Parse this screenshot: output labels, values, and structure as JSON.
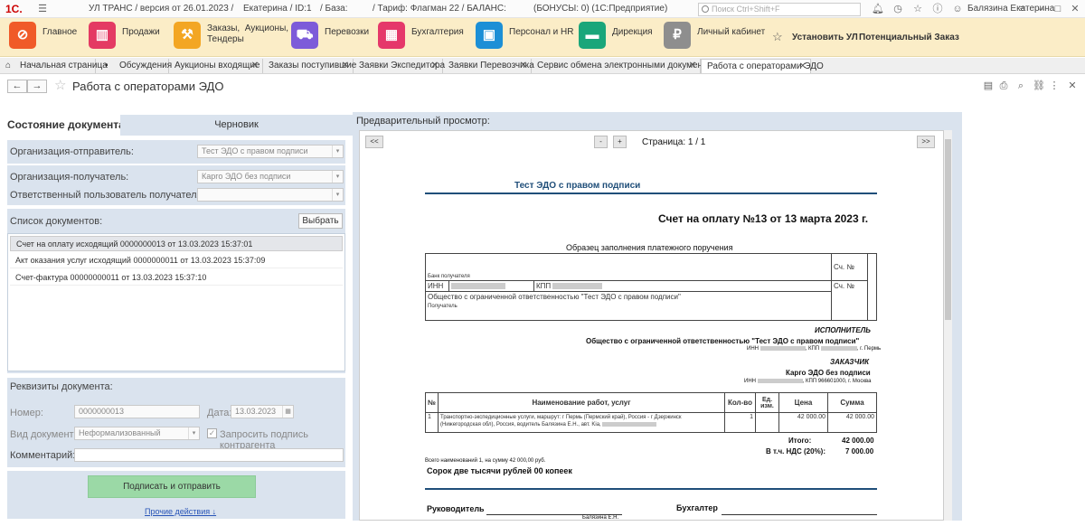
{
  "titlebar": {
    "logo": "1С.",
    "app": "УЛ ТРАНС / версия от 26.01.2023 /",
    "user_id": "Екатерина / ID:1",
    "base": "/ База:",
    "tariff": "/ Тариф: Флагман 22 / БАЛАНС:",
    "bonus": "(БОНУСЫ: 0)  (1С:Предприятие)",
    "search_placeholder": "Поиск Ctrl+Shift+F",
    "user": "Балязина Екатерина"
  },
  "sections": [
    {
      "label": "Главное",
      "color": "#f05a28",
      "icon": "home-icon"
    },
    {
      "label": "Продажи",
      "color": "#e43a63",
      "icon": "sales-chart-icon"
    },
    {
      "label": "Заказы,  Аукционы,\nТендеры",
      "color": "#f3a623",
      "icon": "gavel-icon"
    },
    {
      "label": "Перевозки",
      "color": "#7d5bd9",
      "icon": "truck-icon"
    },
    {
      "label": "Бухгалтерия",
      "color": "#e5386a",
      "icon": "calculator-icon"
    },
    {
      "label": "Персонал и HR",
      "color": "#1c8fd6",
      "icon": "id-card-icon"
    },
    {
      "label": "Дирекция",
      "color": "#1aa67a",
      "icon": "briefcase-icon"
    },
    {
      "label": "Личный кабинет",
      "color": "#8e8e8e",
      "icon": "lock-icon"
    }
  ],
  "section_actions": {
    "install": "Установить УЛ",
    "potential": "Потенциальный Заказ"
  },
  "tabs": [
    {
      "label": "Начальная страница"
    },
    {
      "label": "Обсуждения"
    },
    {
      "label": "Аукционы входящие"
    },
    {
      "label": "Заказы поступившие"
    },
    {
      "label": "Заявки Экспедитора"
    },
    {
      "label": "Заявки Перевозчика"
    },
    {
      "label": "Сервис обмена электронными документами"
    },
    {
      "label": "Работа с операторами ЭДО"
    }
  ],
  "form": {
    "title": "Работа с операторами ЭДО",
    "state_label": "Состояние документа:",
    "state_value": "Черновик",
    "sender_label": "Организация-отправитель:",
    "sender_value": "Тест ЭДО с правом подписи",
    "receiver_label": "Организация-получатель:",
    "receiver_value": "Карго ЭДО без подписи",
    "resp_label": "Ответственный пользователь получателя:",
    "resp_value": "",
    "doclist_label": "Список документов:",
    "choose_btn": "Выбрать",
    "documents": [
      "Счет на оплату исходящий 0000000013 от 13.03.2023 15:37:01",
      "Акт оказания услуг исходящий 0000000011 от 13.03.2023 15:37:09",
      "Счет-фактура 00000000011 от 13.03.2023 15:37:10"
    ],
    "requisites_label": "Реквизиты документа:",
    "number_label": "Номер:",
    "number_value": "0000000013",
    "date_label": "Дата:",
    "date_value": "13.03.2023",
    "doctype_label": "Вид документа:",
    "doctype_value": "Неформализованный",
    "request_sign_label": "Запросить подпись контрагента",
    "comment_label": "Комментарий:",
    "comment_value": "",
    "sign_btn": "Подписать и отправить",
    "other_actions": "Прочие действия ↓"
  },
  "preview": {
    "title": "Предварительный просмотр:",
    "first": "<<",
    "minus": "-",
    "plus": "+",
    "page": "Страница: 1 / 1",
    "last": ">>",
    "doc": {
      "org": "Тест ЭДО с правом подписи",
      "invoice_title": "Счет на оплату №13  от 13 марта 2023 г.",
      "sample": "Образец заполнения платежного поручения",
      "bank": "Банк получателя",
      "sch_no": "Сч. №",
      "inn": "ИНН",
      "kpp": "КПП",
      "recipient_org": "Общество с ограниченной ответственностью \"Тест ЭДО с правом подписи\"",
      "recipient_caption": "Получатель",
      "executor_label": "ИСПОЛНИТЕЛЬ",
      "executor_name": "Общество с ограниченной ответственностью \"Тест ЭДО с правом подписи\"",
      "executor_inn_prefix": "ИНН",
      "executor_kpp_prefix": ", КПП",
      "executor_city": ", г. Пермь",
      "customer_label": "ЗАКАЗЧИК",
      "customer_name": "Карго ЭДО без подписи",
      "customer_inn_prefix": "ИНН",
      "customer_kpp": ", КПП 966601000, г. Москва",
      "table_headers": [
        "№",
        "Наименование работ, услуг",
        "Кол-во",
        "Ед. изм.",
        "Цена",
        "Сумма"
      ],
      "rows": [
        {
          "n": "1",
          "name": "Транспортно-экспедиционные услуги, маршрут: г Пермь (Пермский край), Россия - г Дзержинск (Нижегородская обл), Россия, водитель Балязина Е.Н., авт. Kia,",
          "qty": "1",
          "unit": "",
          "price": "42 000.00",
          "sum": "42 000.00"
        }
      ],
      "total_label": "Итого:",
      "total_value": "42 000.00",
      "vat_label": "В т.ч. НДС (20%):",
      "vat_value": "7 000.00",
      "count_text": "Всего наименований 1, на сумму 42 000,00 руб.",
      "sum_words": "Сорок две тысячи рублей 00 копеек",
      "head_label": "Руководитель",
      "accountant_label": "Бухгалтер",
      "head_name": "Балязина Е.Н."
    }
  }
}
